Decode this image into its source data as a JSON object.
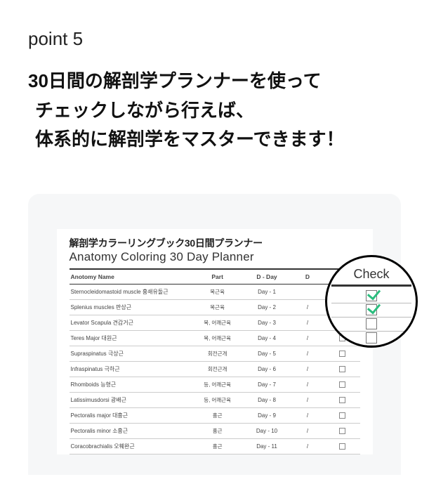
{
  "point_label": "point 5",
  "headline": {
    "line1": "30日間の解剖学プランナーを使って",
    "line2": "チェックしながら行えば、",
    "line3": "体系的に解剖学をマスターできます！"
  },
  "planner": {
    "title_jp": "解剖学カラーリングブック30日間プランナー",
    "title_en": "Anatomy Coloring 30 Day Planner",
    "columns": {
      "name": "Anotomy Name",
      "part": "Part",
      "dday": "D - Day",
      "date_hint": "D",
      "check": "Check"
    },
    "rows": [
      {
        "name": "Sternocleidomastoid muscle 흉쇄유돌근",
        "part": "목근육",
        "dday": "Day - 1",
        "date": ""
      },
      {
        "name": "Splenius muscles 판상근",
        "part": "목근육",
        "dday": "Day - 2",
        "date": "/"
      },
      {
        "name": "Levator Scapula 견갑거근",
        "part": "목, 어깨근육",
        "dday": "Day - 3",
        "date": "/"
      },
      {
        "name": "Teres Major 대원근",
        "part": "목, 어깨근육",
        "dday": "Day - 4",
        "date": "/"
      },
      {
        "name": "Supraspinatus 극상근",
        "part": "회전근개",
        "dday": "Day - 5",
        "date": "/"
      },
      {
        "name": "Infraspinatus 극하근",
        "part": "회전근개",
        "dday": "Day - 6",
        "date": "/"
      },
      {
        "name": "Rhomboids 능형근",
        "part": "등, 어깨근육",
        "dday": "Day - 7",
        "date": "/"
      },
      {
        "name": "Latissimusdorsi 광배근",
        "part": "등, 어깨근육",
        "dday": "Day - 8",
        "date": "/"
      },
      {
        "name": "Pectoralis major 대흉근",
        "part": "흉근",
        "dday": "Day - 9",
        "date": "/"
      },
      {
        "name": "Pectoralis minor 소흉근",
        "part": "흉근",
        "dday": "Day - 10",
        "date": "/"
      },
      {
        "name": "Coracobrachialis 오훼완근",
        "part": "흉근",
        "dday": "Day - 11",
        "date": "/"
      }
    ]
  },
  "magnifier": {
    "label": "Check"
  }
}
